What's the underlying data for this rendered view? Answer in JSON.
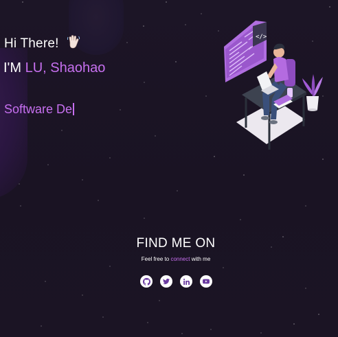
{
  "hero": {
    "greeting": "Hi There!",
    "wave_icon": "waving-hand-icon",
    "name_prefix": "I'M",
    "name": "LU, Shaohao",
    "typed_text": "Software De"
  },
  "illustration": {
    "icon": "developer-at-desk-illustration"
  },
  "find_me": {
    "title": "FIND ME ON",
    "subtitle_before": "Feel free to",
    "subtitle_accent": "connect",
    "subtitle_after": "with me",
    "links": [
      {
        "icon": "github-icon"
      },
      {
        "icon": "twitter-icon"
      },
      {
        "icon": "linkedin-icon"
      },
      {
        "icon": "youtube-icon"
      }
    ]
  },
  "colors": {
    "background": "#1b1425",
    "accent": "#c770f0",
    "text": "#ffffff"
  }
}
